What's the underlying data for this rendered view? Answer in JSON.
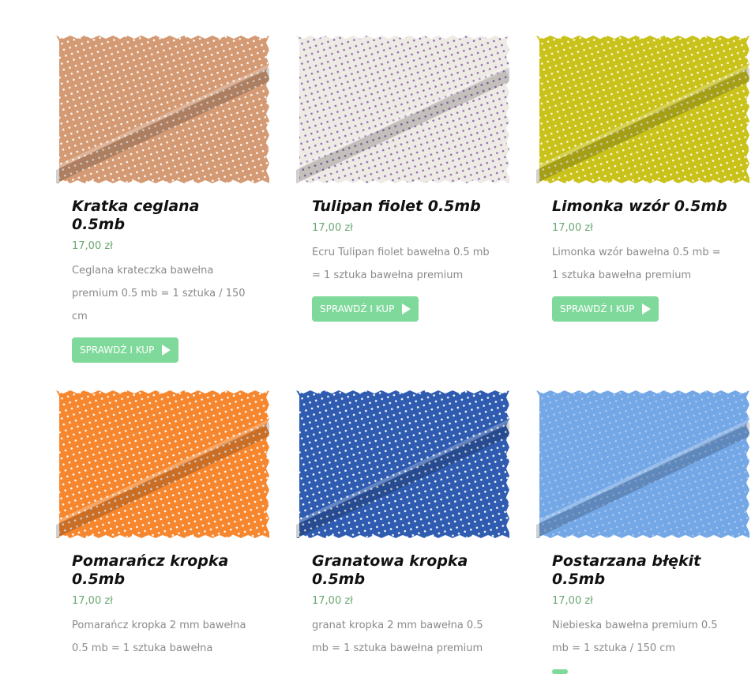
{
  "button_label": "SPRAWDŹ I KUP",
  "products": [
    {
      "title": "Kratka ceglana 0.5mb",
      "price": "17,00 zł",
      "desc": "Ceglana krateczka  bawełna premium 0.5 mb = 1 sztuka / 150 cm",
      "image_name": "brick-check-fabric-image",
      "base_color": "#d49a74",
      "dot_color": "#ffffff"
    },
    {
      "title": "Tulipan fiolet 0.5mb",
      "price": "17,00 zł",
      "desc": "Ecru Tulipan fiolet bawełna 0.5 mb = 1 sztuka bawełna premium",
      "image_name": "tulip-violet-fabric-image",
      "base_color": "#eeeae4",
      "dot_color": "#8d6ab5"
    },
    {
      "title": "Limonka wzór 0.5mb",
      "price": "17,00 zł",
      "desc": "Limonka wzór bawełna 0.5 mb = 1 sztuka bawełna premium",
      "image_name": "lime-floral-fabric-image",
      "base_color": "#c9c21a",
      "dot_color": "#fffbe6"
    },
    {
      "title": "Pomarańcz kropka 0.5mb",
      "price": "17,00 zł",
      "desc": "Pomarańcz kropka 2 mm bawełna 0.5 mb = 1 sztuka bawełna",
      "image_name": "orange-dot-fabric-image",
      "base_color": "#f7872e",
      "dot_color": "#ffffff"
    },
    {
      "title": "Granatowa kropka 0.5mb",
      "price": "17,00 zł",
      "desc": "granat kropka 2 mm  bawełna 0.5 mb = 1 sztuka bawełna premium",
      "image_name": "navy-dot-fabric-image",
      "base_color": "#2f5cb0",
      "dot_color": "#ffffff"
    },
    {
      "title": "Postarzana błękit 0.5mb",
      "price": "17,00 zł",
      "desc": "Niebieska bawełna premium 0.5 mb = 1 sztuka / 150 cm",
      "image_name": "light-blue-fabric-image",
      "base_color": "#74a7e6",
      "dot_color": "#a8c8f2"
    }
  ]
}
